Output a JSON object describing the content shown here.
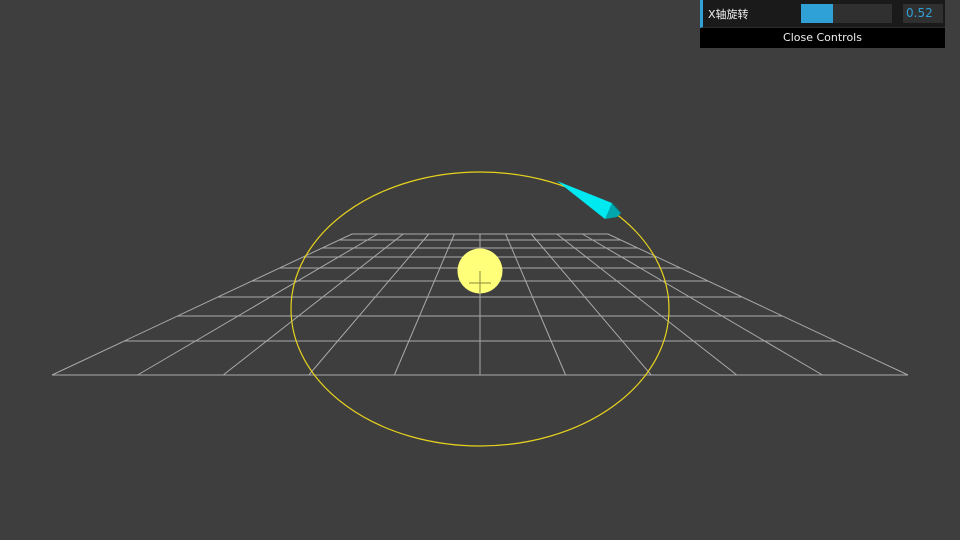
{
  "controls": {
    "x_rotation": {
      "label": "X轴旋转",
      "value": "0.52",
      "fill_fraction": 0.35
    },
    "close_label": "Close Controls"
  },
  "colors": {
    "background": "#3e3e3e",
    "grid": "#a9a9a9",
    "orbit": "#e6d21e",
    "sun": "#ffff7a",
    "cone": "#00e5ee",
    "gui_accent": "#2fa1d6"
  }
}
